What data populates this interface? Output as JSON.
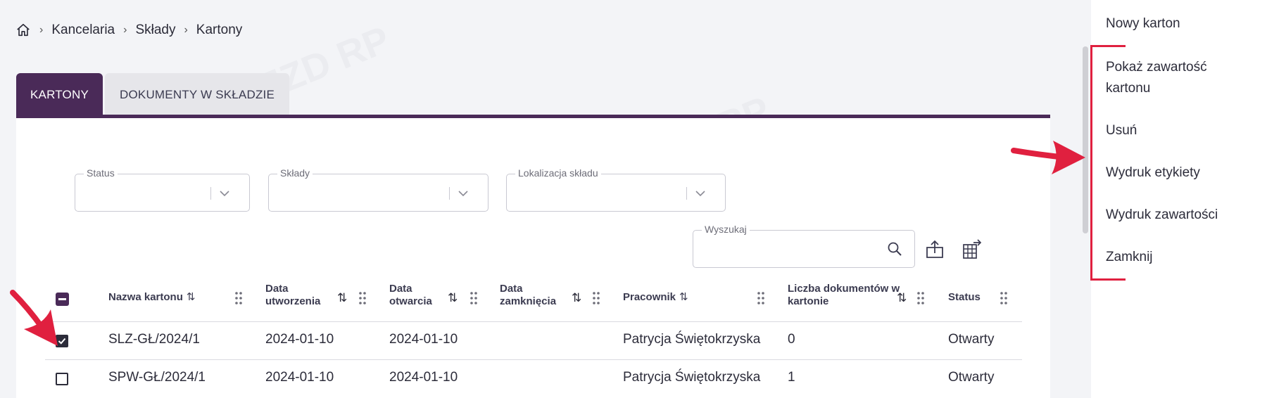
{
  "breadcrumb": {
    "items": [
      "Kancelaria",
      "Składy",
      "Kartony"
    ],
    "separator": "›"
  },
  "tabs": [
    {
      "label": "KARTONY",
      "active": true
    },
    {
      "label": "DOKUMENTY W SKŁADZIE",
      "active": false
    }
  ],
  "filters": {
    "status_label": "Status",
    "sklady_label": "Składy",
    "lokalizacja_label": "Lokalizacja składu",
    "search_label": "Wyszukaj"
  },
  "table": {
    "columns": [
      {
        "label": "Nazwa kartonu"
      },
      {
        "label": "Data utworzenia"
      },
      {
        "label": "Data otwarcia"
      },
      {
        "label": "Data zamknięcia"
      },
      {
        "label": "Pracownik"
      },
      {
        "label": "Liczba dokumentów w kartonie"
      },
      {
        "label": "Status"
      }
    ],
    "rows": [
      {
        "checked": true,
        "nazwa": "SLZ-GŁ/2024/1",
        "utworzenia": "2024-01-10",
        "otwarcia": "2024-01-10",
        "zamkniecia": "",
        "pracownik": "Patrycja Świętokrzyska",
        "liczba": "0",
        "status": "Otwarty"
      },
      {
        "checked": false,
        "nazwa": "SPW-GŁ/2024/1",
        "utworzenia": "2024-01-10",
        "otwarcia": "2024-01-10",
        "zamkniecia": "",
        "pracownik": "Patrycja Świętokrzyska",
        "liczba": "1",
        "status": "Otwarty"
      }
    ]
  },
  "menu": {
    "new": "Nowy karton",
    "items": [
      "Pokaż zawartość kartonu",
      "Usuń",
      "Wydruk etykiety",
      "Wydruk zawartości",
      "Zamknij"
    ]
  },
  "colors": {
    "accent": "#4a2a58",
    "annotation": "#e0203f"
  },
  "icons": [
    "home-icon",
    "chevron-down-icon",
    "search-icon",
    "export-icon",
    "table-export-icon",
    "drag-handle-icon",
    "sort-icon"
  ]
}
